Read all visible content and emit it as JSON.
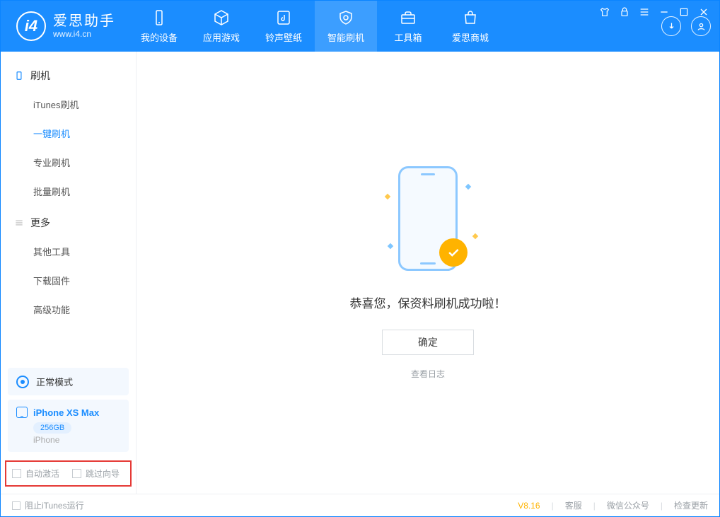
{
  "app": {
    "name_cn": "爱思助手",
    "url": "www.i4.cn"
  },
  "nav": {
    "items": [
      {
        "label": "我的设备"
      },
      {
        "label": "应用游戏"
      },
      {
        "label": "铃声壁纸"
      },
      {
        "label": "智能刷机"
      },
      {
        "label": "工具箱"
      },
      {
        "label": "爱思商城"
      }
    ],
    "active_index": 3
  },
  "sidebar": {
    "group1": {
      "title": "刷机",
      "items": [
        "iTunes刷机",
        "一键刷机",
        "专业刷机",
        "批量刷机"
      ],
      "active_index": 1
    },
    "group2": {
      "title": "更多",
      "items": [
        "其他工具",
        "下载固件",
        "高级功能"
      ]
    },
    "mode": {
      "label": "正常模式"
    },
    "device": {
      "name": "iPhone XS Max",
      "capacity": "256GB",
      "type": "iPhone"
    },
    "checks": {
      "auto_activate": "自动激活",
      "skip_guide": "跳过向导"
    }
  },
  "main": {
    "message": "恭喜您，保资料刷机成功啦！",
    "ok": "确定",
    "view_log": "查看日志"
  },
  "footer": {
    "block_itunes": "阻止iTunes运行",
    "version": "V8.16",
    "links": [
      "客服",
      "微信公众号",
      "检查更新"
    ]
  }
}
